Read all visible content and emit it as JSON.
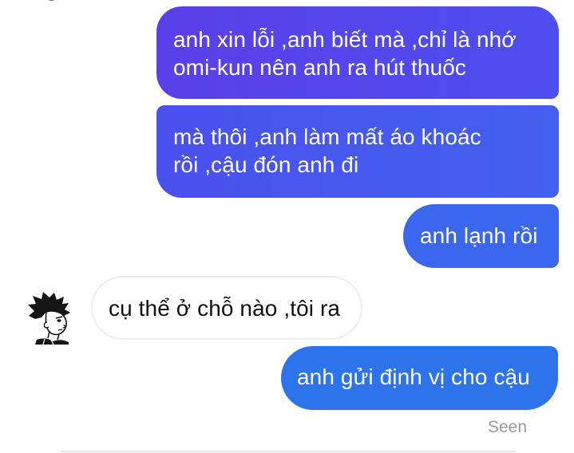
{
  "conversation": {
    "messages": [
      {
        "direction": "outgoing",
        "lines": [
          "anh xin lỗi ,anh biết mà ,chỉ là nhớ",
          "omi-kun nên anh ra hút thuốc"
        ]
      },
      {
        "direction": "outgoing",
        "lines": [
          "mà thôi ,anh làm mất áo khoác",
          "rồi ,cậu đón anh đi"
        ]
      },
      {
        "direction": "outgoing",
        "lines": [
          "anh lạnh rồi"
        ]
      },
      {
        "direction": "incoming",
        "lines": [
          "cụ thể ở chỗ nào ,tôi ra"
        ]
      },
      {
        "direction": "outgoing",
        "lines": [
          "anh gửi định vị cho cậu"
        ]
      }
    ],
    "status": "Seen"
  },
  "avatar": {
    "icon": "manga-character-avatar-icon"
  },
  "colors": {
    "outgoing_gradient_start": "#5a3fe8",
    "outgoing_gradient_end": "#2d73ec",
    "incoming_bubble": "#ffffff",
    "incoming_border": "#eceef0",
    "seen_text": "#9a9a9a"
  }
}
